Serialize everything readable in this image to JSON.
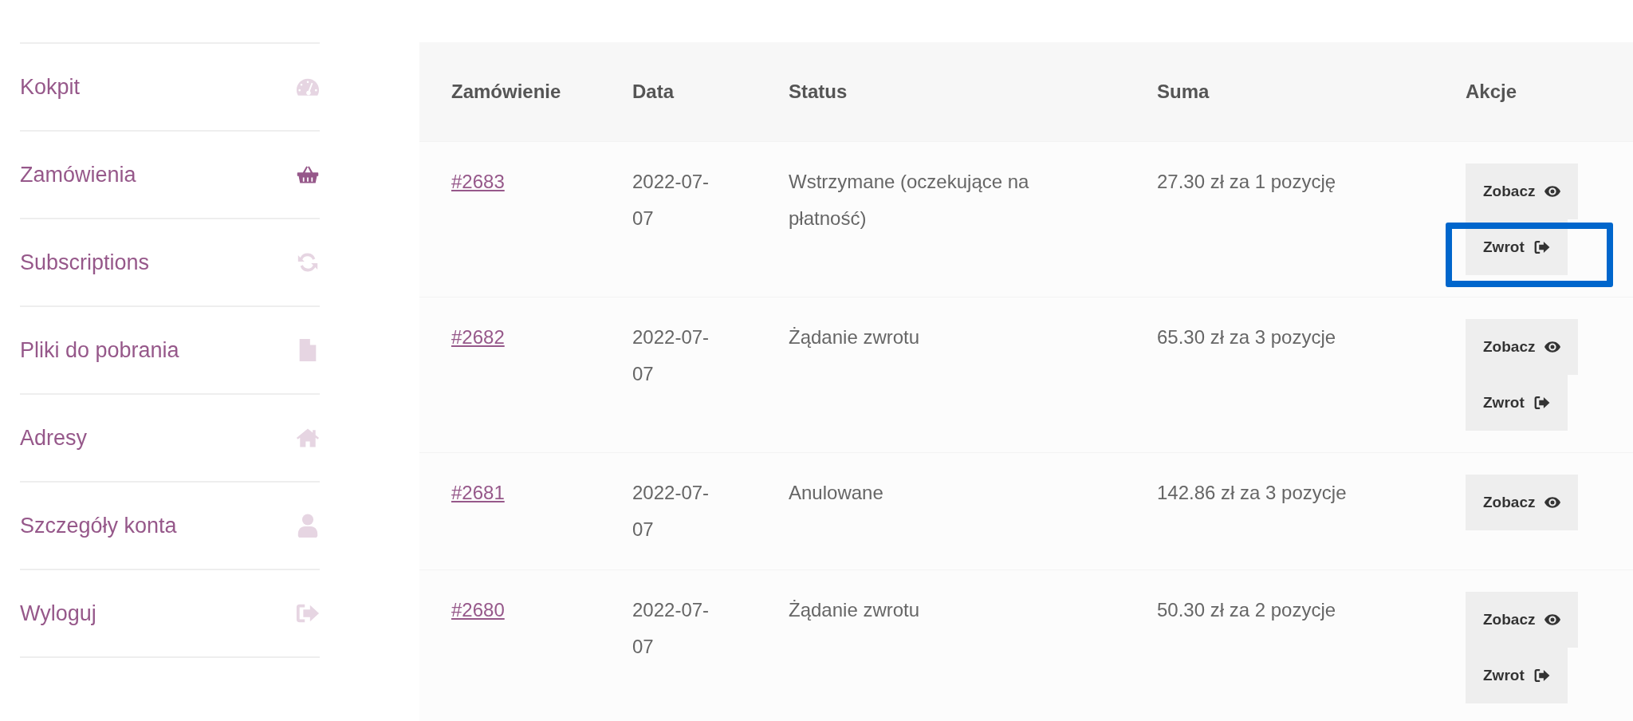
{
  "sidebar": {
    "items": [
      {
        "label": "Kokpit",
        "kind": "gauge",
        "selected": false
      },
      {
        "label": "Zamówienia",
        "kind": "basket",
        "selected": true
      },
      {
        "label": "Subscriptions",
        "kind": "refresh",
        "selected": false
      },
      {
        "label": "Pliki do pobrania",
        "kind": "file",
        "selected": false
      },
      {
        "label": "Adresy",
        "kind": "home",
        "selected": false
      },
      {
        "label": "Szczegóły konta",
        "kind": "user",
        "selected": false
      },
      {
        "label": "Wyloguj",
        "kind": "signout",
        "selected": false
      }
    ]
  },
  "table": {
    "columns": [
      "Zamówienie",
      "Data",
      "Status",
      "Suma",
      "Akcje"
    ],
    "rows": [
      {
        "order": "#2683",
        "date": "2022-07-07",
        "status": "Wstrzymane (oczekujące na płatność)",
        "total": "27.30 zł za 1 pozycję",
        "actions": [
          {
            "label": "Zobacz",
            "kind": "view",
            "highlighted": false
          },
          {
            "label": "Zwrot",
            "kind": "return",
            "highlighted": true
          }
        ]
      },
      {
        "order": "#2682",
        "date": "2022-07-07",
        "status": "Żądanie zwrotu",
        "total": "65.30 zł za 3 pozycje",
        "actions": [
          {
            "label": "Zobacz",
            "kind": "view",
            "highlighted": false
          },
          {
            "label": "Zwrot",
            "kind": "return",
            "highlighted": false
          }
        ]
      },
      {
        "order": "#2681",
        "date": "2022-07-07",
        "status": "Anulowane",
        "total": "142.86 zł za 3 pozycje",
        "actions": [
          {
            "label": "Zobacz",
            "kind": "view",
            "highlighted": false
          }
        ]
      },
      {
        "order": "#2680",
        "date": "2022-07-07",
        "status": "Żądanie zwrotu",
        "total": "50.30 zł za 2 pozycje",
        "actions": [
          {
            "label": "Zobacz",
            "kind": "view",
            "highlighted": false
          },
          {
            "label": "Zwrot",
            "kind": "return",
            "highlighted": false
          }
        ]
      }
    ]
  }
}
